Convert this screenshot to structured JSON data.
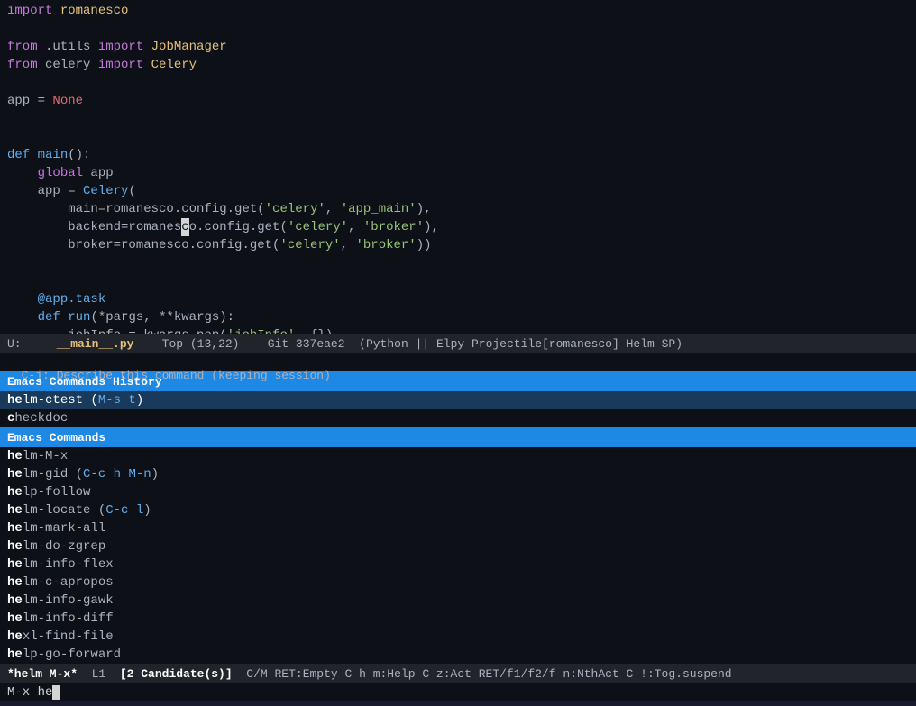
{
  "editor": {
    "lines": [
      {
        "id": 1,
        "content": "import romanesco",
        "parts": [
          {
            "text": "import",
            "cls": "kw-import"
          },
          {
            "text": " romanesco",
            "cls": "mod-name"
          }
        ]
      },
      {
        "id": 2,
        "content": "",
        "parts": []
      },
      {
        "id": 3,
        "content": "from .utils import JobManager",
        "parts": [
          {
            "text": "from",
            "cls": "kw-from"
          },
          {
            "text": " .utils ",
            "cls": "normal"
          },
          {
            "text": "import",
            "cls": "kw-import"
          },
          {
            "text": " JobManager",
            "cls": "mod-name"
          }
        ]
      },
      {
        "id": 4,
        "content": "from celery import Celery",
        "parts": [
          {
            "text": "from",
            "cls": "kw-from"
          },
          {
            "text": " celery ",
            "cls": "normal"
          },
          {
            "text": "import",
            "cls": "kw-import"
          },
          {
            "text": " Celery",
            "cls": "mod-name"
          }
        ]
      },
      {
        "id": 5,
        "content": "",
        "parts": []
      },
      {
        "id": 6,
        "content": "app = None",
        "parts": [
          {
            "text": "app",
            "cls": "normal"
          },
          {
            "text": " = ",
            "cls": "normal"
          },
          {
            "text": "None",
            "cls": "kw-none"
          }
        ]
      },
      {
        "id": 7,
        "content": "",
        "parts": []
      },
      {
        "id": 8,
        "content": "",
        "parts": []
      },
      {
        "id": 9,
        "content": "def main():",
        "parts": [
          {
            "text": "def",
            "cls": "kw-def"
          },
          {
            "text": " ",
            "cls": "normal"
          },
          {
            "text": "main",
            "cls": "func-name"
          },
          {
            "text": "():",
            "cls": "normal"
          }
        ]
      },
      {
        "id": 10,
        "content": "    global app",
        "parts": [
          {
            "text": "    ",
            "cls": "normal"
          },
          {
            "text": "global",
            "cls": "kw-global"
          },
          {
            "text": " app",
            "cls": "normal"
          }
        ]
      },
      {
        "id": 11,
        "content": "    app = Celery(",
        "parts": [
          {
            "text": "    app = ",
            "cls": "normal"
          },
          {
            "text": "Celery",
            "cls": "func-name"
          },
          {
            "text": "(",
            "cls": "normal"
          }
        ]
      },
      {
        "id": 12,
        "content": "        main=romanesco.config.get('celery', 'app_main'),",
        "parts": [
          {
            "text": "        main=romanesco.config.get(",
            "cls": "normal"
          },
          {
            "text": "'celery'",
            "cls": "str-single"
          },
          {
            "text": ", ",
            "cls": "normal"
          },
          {
            "text": "'app_main'",
            "cls": "str-single"
          },
          {
            "text": "),",
            "cls": "normal"
          }
        ]
      },
      {
        "id": 13,
        "content": "        backend=romanesco.config.get('celery', 'broker'),",
        "parts": [
          {
            "text": "        backend=romanes",
            "cls": "normal"
          },
          {
            "text": "c",
            "cls": "cursor-block"
          },
          {
            "text": "o.config.get(",
            "cls": "normal"
          },
          {
            "text": "'celery'",
            "cls": "str-single"
          },
          {
            "text": ", ",
            "cls": "normal"
          },
          {
            "text": "'broker'",
            "cls": "str-single"
          },
          {
            "text": "),",
            "cls": "normal"
          }
        ]
      },
      {
        "id": 14,
        "content": "        broker=romanesco.config.get('celery', 'broker'))",
        "parts": [
          {
            "text": "        broker=romanesco.config.get(",
            "cls": "normal"
          },
          {
            "text": "'celery'",
            "cls": "str-single"
          },
          {
            "text": ", ",
            "cls": "normal"
          },
          {
            "text": "'broker'",
            "cls": "str-single"
          },
          {
            "text": "))",
            "cls": "normal"
          }
        ]
      },
      {
        "id": 15,
        "content": "",
        "parts": []
      },
      {
        "id": 16,
        "content": "",
        "parts": []
      },
      {
        "id": 17,
        "content": "    @app.task",
        "parts": [
          {
            "text": "    ",
            "cls": "normal"
          },
          {
            "text": "@app.task",
            "cls": "decorator"
          }
        ]
      },
      {
        "id": 18,
        "content": "    def run(*pargs, **kwargs):",
        "parts": [
          {
            "text": "    ",
            "cls": "normal"
          },
          {
            "text": "def",
            "cls": "kw-def"
          },
          {
            "text": " ",
            "cls": "normal"
          },
          {
            "text": "run",
            "cls": "func-name"
          },
          {
            "text": "(*pargs, **kwargs):",
            "cls": "normal"
          }
        ]
      },
      {
        "id": 19,
        "content": "        jobInfo = kwargs.pop('jobInfo', {})",
        "parts": [
          {
            "text": "        jobInfo = kwargs.pop(",
            "cls": "normal"
          },
          {
            "text": "'jobInfo'",
            "cls": "str-single"
          },
          {
            "text": ", {})",
            "cls": "normal"
          }
        ]
      }
    ],
    "filename": "__main__.py",
    "position": "Top (13,22)",
    "git": "Git-337eae2",
    "mode": "Python || Elpy Projectile[romanesco] Helm SP"
  },
  "status_bar": {
    "mode_indicator": "U:---",
    "filename": "__main__.py",
    "position": "Top (13,22)",
    "git": "Git-337eae2",
    "mode": "(Python || Elpy Projectile[romanesco] Helm SP)"
  },
  "minibuffer": {
    "text": "C-j: Describe this command (keeping session)"
  },
  "helm_history": {
    "header": "Emacs Commands History",
    "items": [
      {
        "text": "helm-ctest (M-s t)",
        "bold_prefix": "he",
        "rest": "lm-ctest (M-s t)",
        "key": "",
        "selected": true
      },
      {
        "text": "checkdoc",
        "bold_prefix": "c",
        "rest": "heckdoc",
        "key": "",
        "selected": false
      }
    ]
  },
  "helm_commands": {
    "header": "Emacs Commands",
    "items": [
      {
        "bold_prefix": "he",
        "rest": "lm-M-x",
        "key": ""
      },
      {
        "bold_prefix": "he",
        "rest": "lm-gid (",
        "key": "C-c h M-n",
        "suffix": ")"
      },
      {
        "bold_prefix": "he",
        "rest": "lp-follow",
        "key": ""
      },
      {
        "bold_prefix": "he",
        "rest": "lm-locate (",
        "key": "C-c l",
        "suffix": ")"
      },
      {
        "bold_prefix": "he",
        "rest": "lm-mark-all",
        "key": ""
      },
      {
        "bold_prefix": "he",
        "rest": "lm-do-zgrep",
        "key": ""
      },
      {
        "bold_prefix": "he",
        "rest": "lm-info-flex",
        "key": ""
      },
      {
        "bold_prefix": "he",
        "rest": "lm-c-apropos",
        "key": ""
      },
      {
        "bold_prefix": "he",
        "rest": "lm-info-gawk",
        "key": ""
      },
      {
        "bold_prefix": "he",
        "rest": "lm-info-diff",
        "key": ""
      },
      {
        "bold_prefix": "he",
        "rest": "xl-find-file",
        "key": ""
      },
      {
        "bold_prefix": "he",
        "rest": "lp-go-forward",
        "key": ""
      }
    ]
  },
  "bottom_status": {
    "prefix": "*helm M-x*",
    "line": "L1",
    "candidates": "[2 Candidate(s)]",
    "keys": "C/M-RET:Empty C-h m:Help C-z:Act RET/f1/f2/f-n:NthAct C-!:Tog.suspend"
  },
  "input": {
    "prompt": "M-x",
    "value": "he"
  }
}
